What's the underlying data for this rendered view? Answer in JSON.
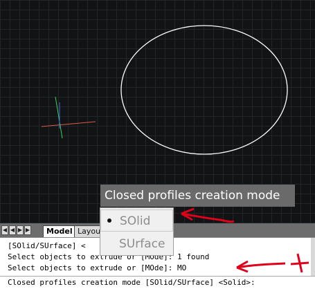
{
  "tooltip": {
    "text": "Closed profiles creation mode"
  },
  "option_menu": {
    "options": [
      {
        "label": "SOlid",
        "selected": true
      },
      {
        "label": "SUrface",
        "selected": false
      }
    ]
  },
  "tabs": [
    {
      "label": "Model",
      "active": true
    },
    {
      "label": "Layout"
    }
  ],
  "command_history": [
    "[SOlid/SUrface] <",
    "Select objects to extrude or [MOde]: 1 found",
    "Select objects to extrude or [MOde]: MO"
  ],
  "command_prompt": "Closed profiles creation mode [SOlid/SUrface] <Solid>:",
  "colors": {
    "ucs_x_axis": "#e05a4a",
    "ucs_y_axis": "#39d25a",
    "ucs_z_axis": "#4a6bdc",
    "annotation": "#e0001a",
    "circle": "#ffffff"
  }
}
